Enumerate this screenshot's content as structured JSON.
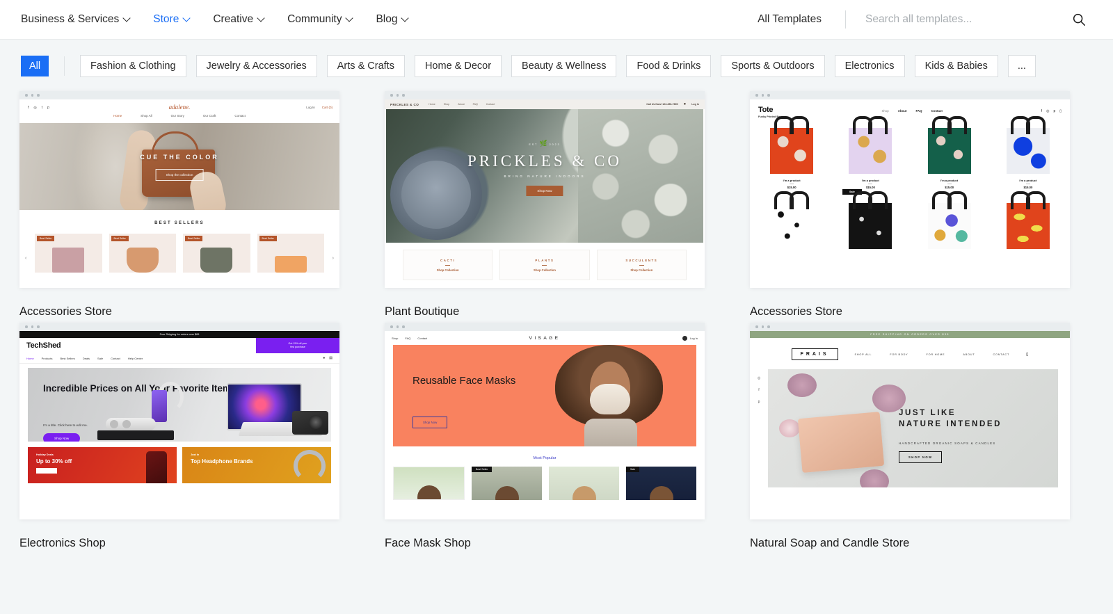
{
  "header": {
    "nav": [
      {
        "label": "Business & Services",
        "active": false,
        "caret": true
      },
      {
        "label": "Store",
        "active": true,
        "caret": true
      },
      {
        "label": "Creative",
        "active": false,
        "caret": true
      },
      {
        "label": "Community",
        "active": false,
        "caret": true
      },
      {
        "label": "Blog",
        "active": false,
        "caret": true
      }
    ],
    "all_templates_label": "All Templates",
    "search_placeholder": "Search all templates...",
    "search_value": "",
    "search_icon": "search-icon",
    "accent_color": "#1a6ef5"
  },
  "filters": {
    "all_label": "All",
    "chips": [
      "Fashion & Clothing",
      "Jewelry & Accessories",
      "Arts & Crafts",
      "Home & Decor",
      "Beauty & Wellness",
      "Food & Drinks",
      "Sports & Outdoors",
      "Electronics",
      "Kids & Babies"
    ],
    "more_label": "..."
  },
  "templates": [
    {
      "title": "Accessories Store"
    },
    {
      "title": "Plant Boutique"
    },
    {
      "title": "Accessories Store"
    },
    {
      "title": "Electronics Shop"
    },
    {
      "title": "Face Mask Shop"
    },
    {
      "title": "Natural Soap and Candle Store"
    }
  ],
  "preview1": {
    "logo": "adalene.",
    "social": [
      "f",
      "◎",
      "t",
      "p"
    ],
    "login": "Log In",
    "cart": "Cart (0)",
    "menu": [
      "Home",
      "Shop All",
      "Our Story",
      "Our Craft",
      "Contact"
    ],
    "hero_title": "CUE THE COLOR",
    "hero_button": "Shop the collection",
    "section_title": "BEST SELLERS",
    "badge": "Best Seller",
    "arrow_prev": "‹",
    "arrow_next": "›"
  },
  "preview2": {
    "logo": "PRICKLES & CO",
    "menu": [
      "Home",
      "Shop",
      "About",
      "FAQ",
      "Contact"
    ],
    "phone": "Call Us Now! 123-456-7890",
    "login": "Log In",
    "emblem_left": "EST",
    "emblem_right": "2023",
    "title": "PRICKLES & CO",
    "subtitle": "BRING NATURE INDOORS",
    "button": "Shop Now",
    "columns": [
      {
        "title": "CACTI",
        "link": "Shop Collection"
      },
      {
        "title": "PLANTS",
        "link": "Shop Collection"
      },
      {
        "title": "SUCCULENTS",
        "link": "Shop Collection"
      }
    ]
  },
  "preview3": {
    "logo": "Tote",
    "tagline": "Funky Printed Bags",
    "menu": [
      "Shop",
      "About",
      "FAQ",
      "Contact"
    ],
    "social": [
      "f",
      "◎",
      "p",
      "▯"
    ],
    "products": [
      {
        "name": "I'm a product",
        "price": "$15.00"
      },
      {
        "name": "I'm a product",
        "price": "$15.00"
      },
      {
        "name": "I'm a product",
        "price": "$15.00"
      },
      {
        "name": "I'm a product",
        "price": "$15.00"
      }
    ],
    "sale_badge": "Sale"
  },
  "preview4": {
    "shipping": "Free Shipping for orders over $65",
    "logo": "TechShed",
    "promo_line1": "Get 15% off your",
    "promo_line2": "first purchase",
    "menu": [
      "Home",
      "Products",
      "Best Sellers",
      "Deals",
      "Sale",
      "Contact",
      "Help Center"
    ],
    "hero_title": "Incredible Prices on All Your Favorite Items",
    "hero_sub": "I'm a title. Click here to edit me.",
    "hero_button": "Shop Now",
    "tiles": [
      {
        "kicker": "Holiday Deals",
        "title": "Up to 30% off"
      },
      {
        "kicker": "Just In",
        "title": "Top Headphone Brands"
      }
    ]
  },
  "preview5": {
    "menu": [
      "Shop",
      "FAQ",
      "Contact"
    ],
    "logo": "VISAGE",
    "login": "Log In",
    "hero_title": "Reusable Face Masks",
    "hero_button": "Shop Now",
    "section_title": "Most Popular",
    "badge_bestseller": "Best Seller",
    "badge_sale": "Sale"
  },
  "preview6": {
    "shipping": "FREE SHIPPING ON ORDERS OVER $35",
    "logo": "FRAIS",
    "menu": [
      "SHOP ALL",
      "FOR BODY",
      "FOR HOME",
      "ABOUT",
      "CONTACT"
    ],
    "social": [
      "◎",
      "f",
      "p"
    ],
    "hero_title_l1": "JUST LIKE",
    "hero_title_l2": "NATURE INTENDED",
    "hero_sub": "HANDCRAFTED ORGANIC SOAPS & CANDLES",
    "hero_button": "SHOP NOW"
  }
}
